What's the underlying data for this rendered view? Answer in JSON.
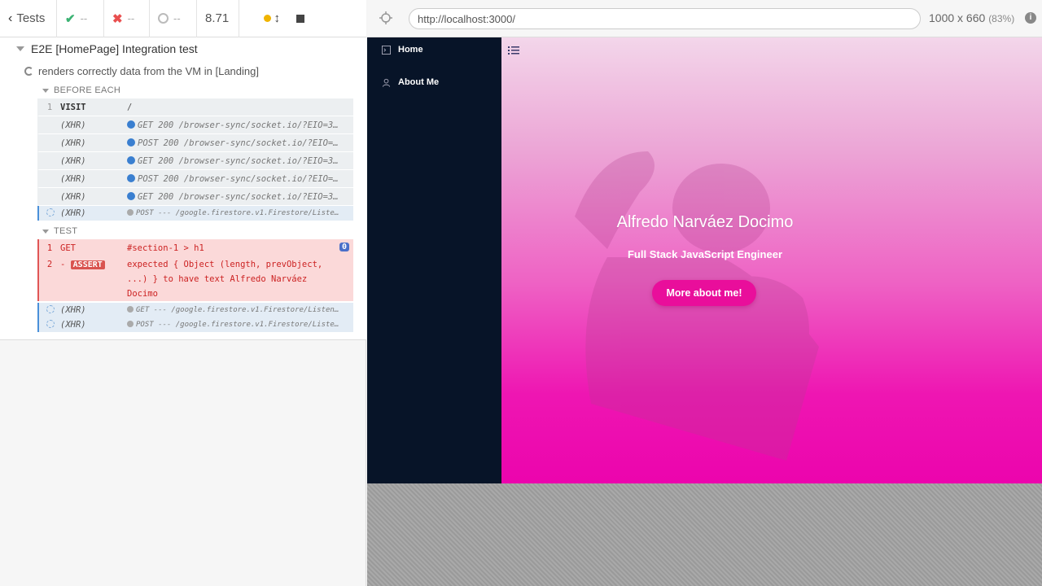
{
  "topbar": {
    "tests_label": "Tests",
    "passed": "--",
    "failed": "--",
    "pending": "--",
    "duration": "8.71"
  },
  "reporter": {
    "suite_title": "E2E [HomePage] Integration test",
    "test_title": "renders correctly data from the VM in [Landing]",
    "before_each_label": "BEFORE EACH",
    "test_label": "TEST",
    "before_each": [
      {
        "num": "1",
        "name": "VISIT",
        "msg": "/"
      },
      {
        "num": "",
        "name": "(XHR)",
        "msg": "GET 200 /browser-sync/socket.io/?EIO=3…"
      },
      {
        "num": "",
        "name": "(XHR)",
        "msg": "POST 200 /browser-sync/socket.io/?EIO=…"
      },
      {
        "num": "",
        "name": "(XHR)",
        "msg": "GET 200 /browser-sync/socket.io/?EIO=3…"
      },
      {
        "num": "",
        "name": "(XHR)",
        "msg": "POST 200 /browser-sync/socket.io/?EIO=…"
      },
      {
        "num": "",
        "name": "(XHR)",
        "msg": "GET 200 /browser-sync/socket.io/?EIO=3…"
      },
      {
        "num": "",
        "name": "(XHR)",
        "msg": "POST --- /google.firestore.v1.Firestore/Liste…"
      }
    ],
    "test_cmds": {
      "get_num": "1",
      "get_name": "GET",
      "get_msg": "#section-1 > h1",
      "get_badge": "0",
      "assert_num": "2",
      "assert_name": "ASSERT",
      "assert_prefix": "-",
      "assert_line1": "expected { Object (length, prevObject,",
      "assert_line2": "...) } to have text Alfredo Narváez",
      "assert_line3": "Docimo",
      "xhr1_name": "(XHR)",
      "xhr1_msg": "GET --- /google.firestore.v1.Firestore/Listen…",
      "xhr2_name": "(XHR)",
      "xhr2_msg": "POST --- /google.firestore.v1.Firestore/Liste…"
    }
  },
  "browser": {
    "url": "http://localhost:3000/",
    "viewport": "1000 x 660",
    "scale": "(83%)"
  },
  "app": {
    "nav": [
      {
        "label": "Home",
        "icon": "terminal-icon"
      },
      {
        "label": "About Me",
        "icon": "user-icon"
      }
    ],
    "hero_title": "Alfredo Narváez Docimo",
    "hero_subtitle": "Full Stack JavaScript Engineer",
    "hero_button": "More about me!",
    "colors": {
      "sidebar": "#071428",
      "hero_pink": "#ec04ad",
      "button": "#e90e9b"
    }
  }
}
